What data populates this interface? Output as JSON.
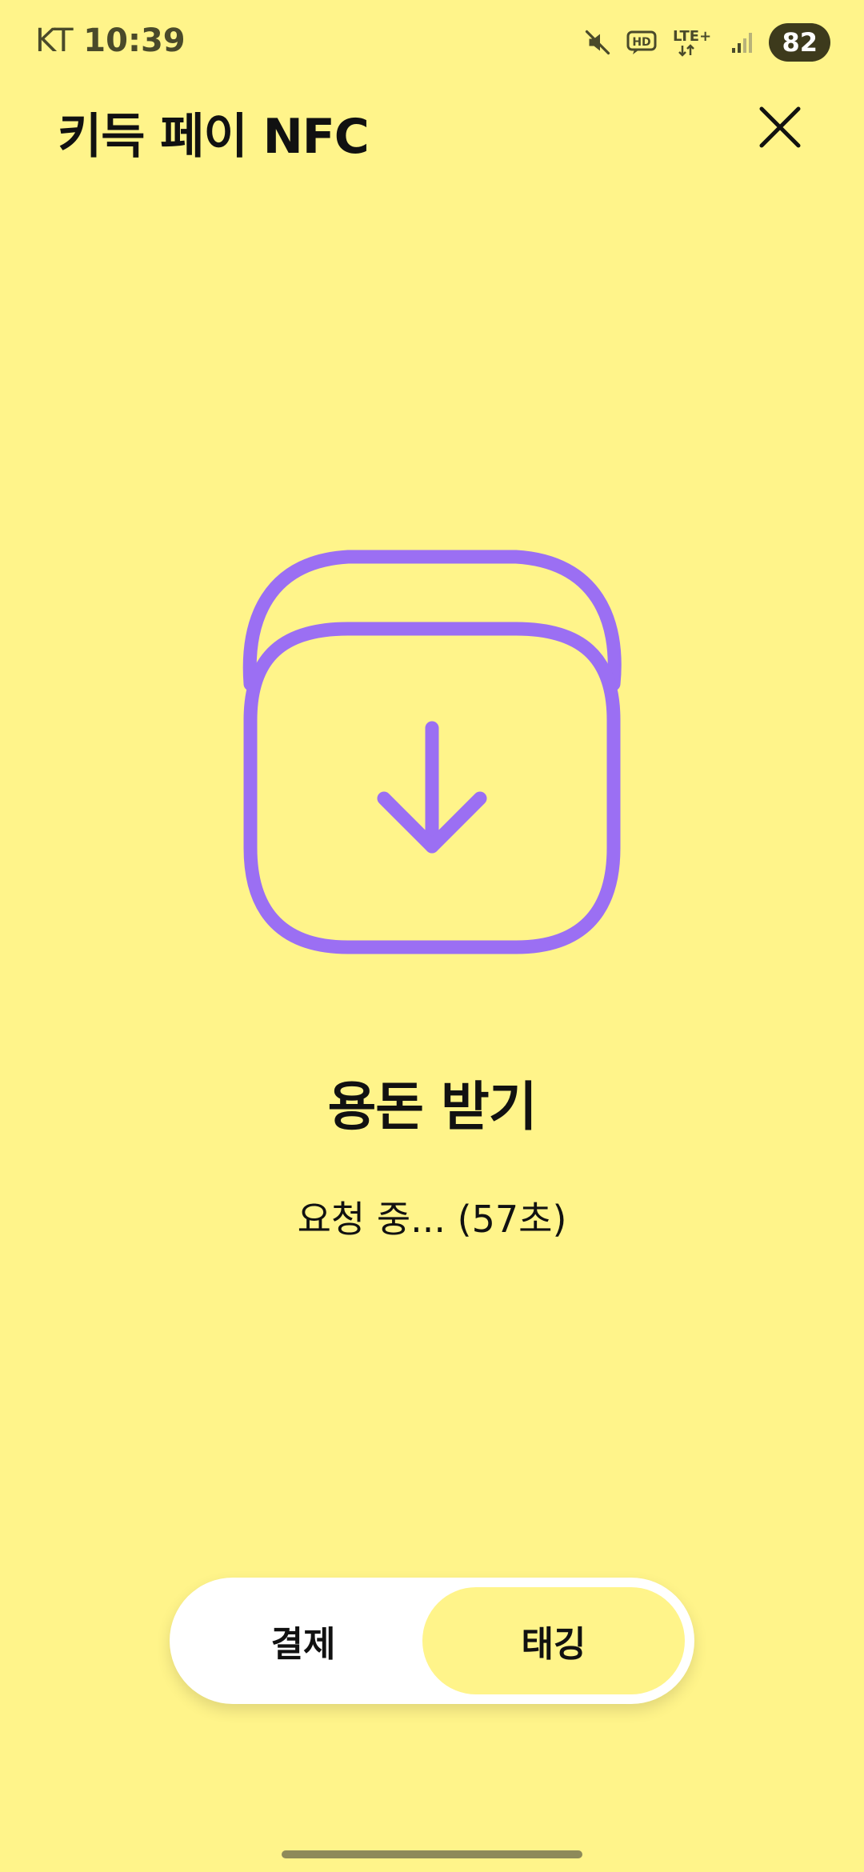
{
  "status_bar": {
    "carrier": "KT",
    "time": "10:39",
    "hd_label": "HD",
    "lte_label": "LTE+",
    "battery": "82",
    "icons": [
      "mute-icon",
      "hd-voice-icon",
      "lte-icon",
      "signal-icon",
      "battery-icon"
    ]
  },
  "header": {
    "title": "키득 페이 NFC",
    "close_icon": "close-icon"
  },
  "main": {
    "icon": "receive-download-icon",
    "icon_color": "#9B6FF3",
    "title": "용돈 받기",
    "status": "요청 중... (57초)"
  },
  "toggle": {
    "options": [
      {
        "label": "결제",
        "selected": false
      },
      {
        "label": "태깅",
        "selected": true
      }
    ]
  },
  "colors": {
    "background": "#FFF48A",
    "accent": "#9B6FF3",
    "toggle_bg": "#FFFFFF"
  }
}
